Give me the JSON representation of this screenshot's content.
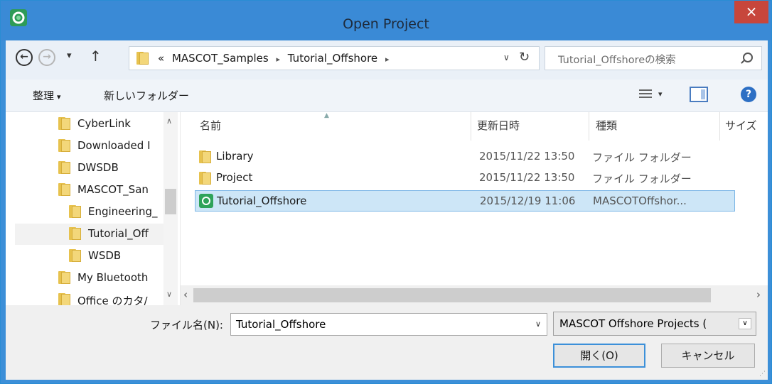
{
  "window": {
    "title": "Open Project",
    "close_glyph": "×"
  },
  "address_bar": {
    "back_glyph": "←",
    "forward_glyph": "→",
    "recent_glyph": "▾",
    "up_glyph": "↑",
    "overflow": "«",
    "crumbs": [
      "MASCOT_Samples",
      "Tutorial_Offshore"
    ],
    "crumb_sep": "▸",
    "dropdown_glyph": "∨",
    "refresh_glyph": "↻",
    "search_placeholder": "Tutorial_Offshoreの検索"
  },
  "toolbar": {
    "organize_label": "整理",
    "organize_caret": "▾",
    "new_folder_label": "新しいフォルダー",
    "view_caret": "▾",
    "help_glyph": "?"
  },
  "nav_pane": {
    "items": [
      {
        "label": "CyberLink"
      },
      {
        "label": "Downloaded I"
      },
      {
        "label": "DWSDB"
      },
      {
        "label": "MASCOT_San"
      },
      {
        "label": "Engineering_"
      },
      {
        "label": "Tutorial_Off"
      },
      {
        "label": "WSDB"
      },
      {
        "label": "My Bluetooth"
      },
      {
        "label": "Office のカタ/"
      }
    ],
    "scroll_up": "∧",
    "scroll_down": "∨"
  },
  "file_list": {
    "columns": {
      "name": "名前",
      "date": "更新日時",
      "type": "種類",
      "size": "サイズ"
    },
    "sort_glyph": "▲",
    "rows": [
      {
        "name": "Library",
        "date": "2015/11/22 13:50",
        "type": "ファイル フォルダー"
      },
      {
        "name": "Project",
        "date": "2015/11/22 13:50",
        "type": "ファイル フォルダー"
      },
      {
        "name": "Tutorial_Offshore",
        "date": "2015/12/19 11:06",
        "type": "MASCOTOffshor..."
      }
    ],
    "hscroll_left": "‹",
    "hscroll_right": "›"
  },
  "bottom": {
    "filename_label": "ファイル名(N):",
    "filename_value": "Tutorial_Offshore",
    "filename_drop": "∨",
    "filetype_value": "MASCOT Offshore Projects (",
    "filetype_drop": "∨",
    "open_label": "開く(O)",
    "cancel_label": "キャンセル",
    "grip": "⋰"
  },
  "colors": {
    "titlebar": "#3a8ad6",
    "close": "#c7463c",
    "selection": "#cde6f7",
    "accent": "#3c90d9"
  }
}
